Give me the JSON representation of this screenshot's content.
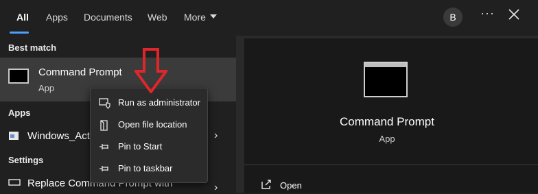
{
  "tabs": [
    {
      "label": "All"
    },
    {
      "label": "Apps"
    },
    {
      "label": "Documents"
    },
    {
      "label": "Web"
    },
    {
      "label": "More"
    }
  ],
  "header": {
    "avatar_letter": "B",
    "more_options": "···"
  },
  "best_match": {
    "section_label": "Best match",
    "title": "Command Prompt",
    "subtitle": "App"
  },
  "apps": {
    "section_label": "Apps",
    "items": [
      {
        "label": "Windows_Act"
      }
    ]
  },
  "settings": {
    "section_label": "Settings",
    "items": [
      {
        "label": "Replace Command Prompt with"
      }
    ]
  },
  "context_menu": {
    "items": [
      {
        "label": "Run as administrator",
        "icon": "shield-icon"
      },
      {
        "label": "Open file location",
        "icon": "folder-icon"
      },
      {
        "label": "Pin to Start",
        "icon": "pin-icon"
      },
      {
        "label": "Pin to taskbar",
        "icon": "pin-icon"
      }
    ]
  },
  "detail": {
    "title": "Command Prompt",
    "subtitle": "App",
    "actions": [
      {
        "label": "Open",
        "icon": "open-icon"
      }
    ]
  },
  "colors": {
    "accent": "#4ca0ff",
    "annotation_arrow": "#e0262b",
    "selected_row": "#3b3b3b"
  }
}
